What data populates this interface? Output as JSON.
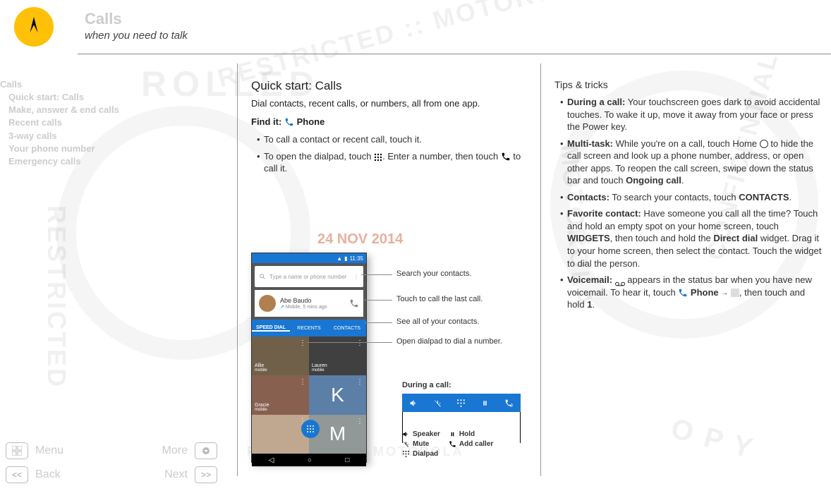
{
  "header": {
    "title": "Calls",
    "subtitle": "when you need to talk"
  },
  "sidebar": {
    "title": "Calls",
    "items": [
      "Quick start: Calls",
      "Make, answer & end calls",
      "Recent calls",
      "3-way calls",
      "Your phone number",
      "Emergency calls"
    ]
  },
  "nav": {
    "menu": "Menu",
    "more": "More",
    "back": "Back",
    "next": "Next",
    "back_sym": "<<",
    "next_sym": ">>"
  },
  "date_stamp": "24 NOV 2014",
  "mid": {
    "h2": "Quick start: Calls",
    "intro": "Dial contacts, recent calls, or numbers, all from one app.",
    "find_it_label": "Find it:",
    "find_it_app": "Phone",
    "b1": "To call a contact or recent call, touch it.",
    "b2a": "To open the dialpad, touch ",
    "b2b": ". Enter a number, then touch ",
    "b2c": " to call it."
  },
  "phone": {
    "time": "11:35",
    "search_placeholder": "Type a name or phone number",
    "recent_name": "Abe Baudo",
    "recent_sub": "Mobile, 5 mins ago",
    "tab1": "SPEED DIAL",
    "tab2": "RECENTS",
    "tab3": "CONTACTS",
    "tile1_name": "Allie",
    "tile1_sub": "mobile",
    "tile2_name": "Lauren",
    "tile2_sub": "mobile",
    "tile3_name": "Gracie",
    "tile3_sub": "mobile",
    "letter_k": "K",
    "letter_m": "M"
  },
  "callouts": {
    "c1": "Search your contacts.",
    "c2": "Touch to call the last call.",
    "c3": "See all of your contacts.",
    "c4": "Open dialpad to dial a number."
  },
  "during": {
    "title": "During a call:",
    "speaker": "Speaker",
    "mute": "Mute",
    "dialpad": "Dialpad",
    "hold": "Hold",
    "add": "Add caller"
  },
  "tips": {
    "title": "Tips & tricks",
    "t1_b": "During a call:",
    "t1": " Your touchscreen goes dark to avoid accidental touches. To wake it up, move it away from your face or press the Power key.",
    "t2_b": "Multi-task:",
    "t2a": " While you're on a call, touch Home ",
    "t2b": " to hide the call screen and look up a phone number, address, or open other apps. To reopen the call screen, swipe down the status bar and touch ",
    "t2c": "Ongoing call",
    "t2d": ".",
    "t3_b": "Contacts:",
    "t3a": " To search your contacts, touch ",
    "t3c": "CONTACTS",
    "t3d": ".",
    "t4_b": "Favorite contact:",
    "t4a": " Have someone you call all the time? Touch and hold an empty spot on your home screen, touch ",
    "t4w": "WIDGETS",
    "t4b": ", then touch and hold the ",
    "t4dd": "Direct dial",
    "t4c": " widget. Drag it to your home screen, then select the contact. Touch the widget to dial the person.",
    "t5_b": "Voicemail:",
    "t5a": " appears in the status bar when you have new voicemail. To hear it, touch ",
    "t5p": "Phone",
    "t5b": ", then touch and hold ",
    "t5one": "1",
    "t5c": "."
  }
}
